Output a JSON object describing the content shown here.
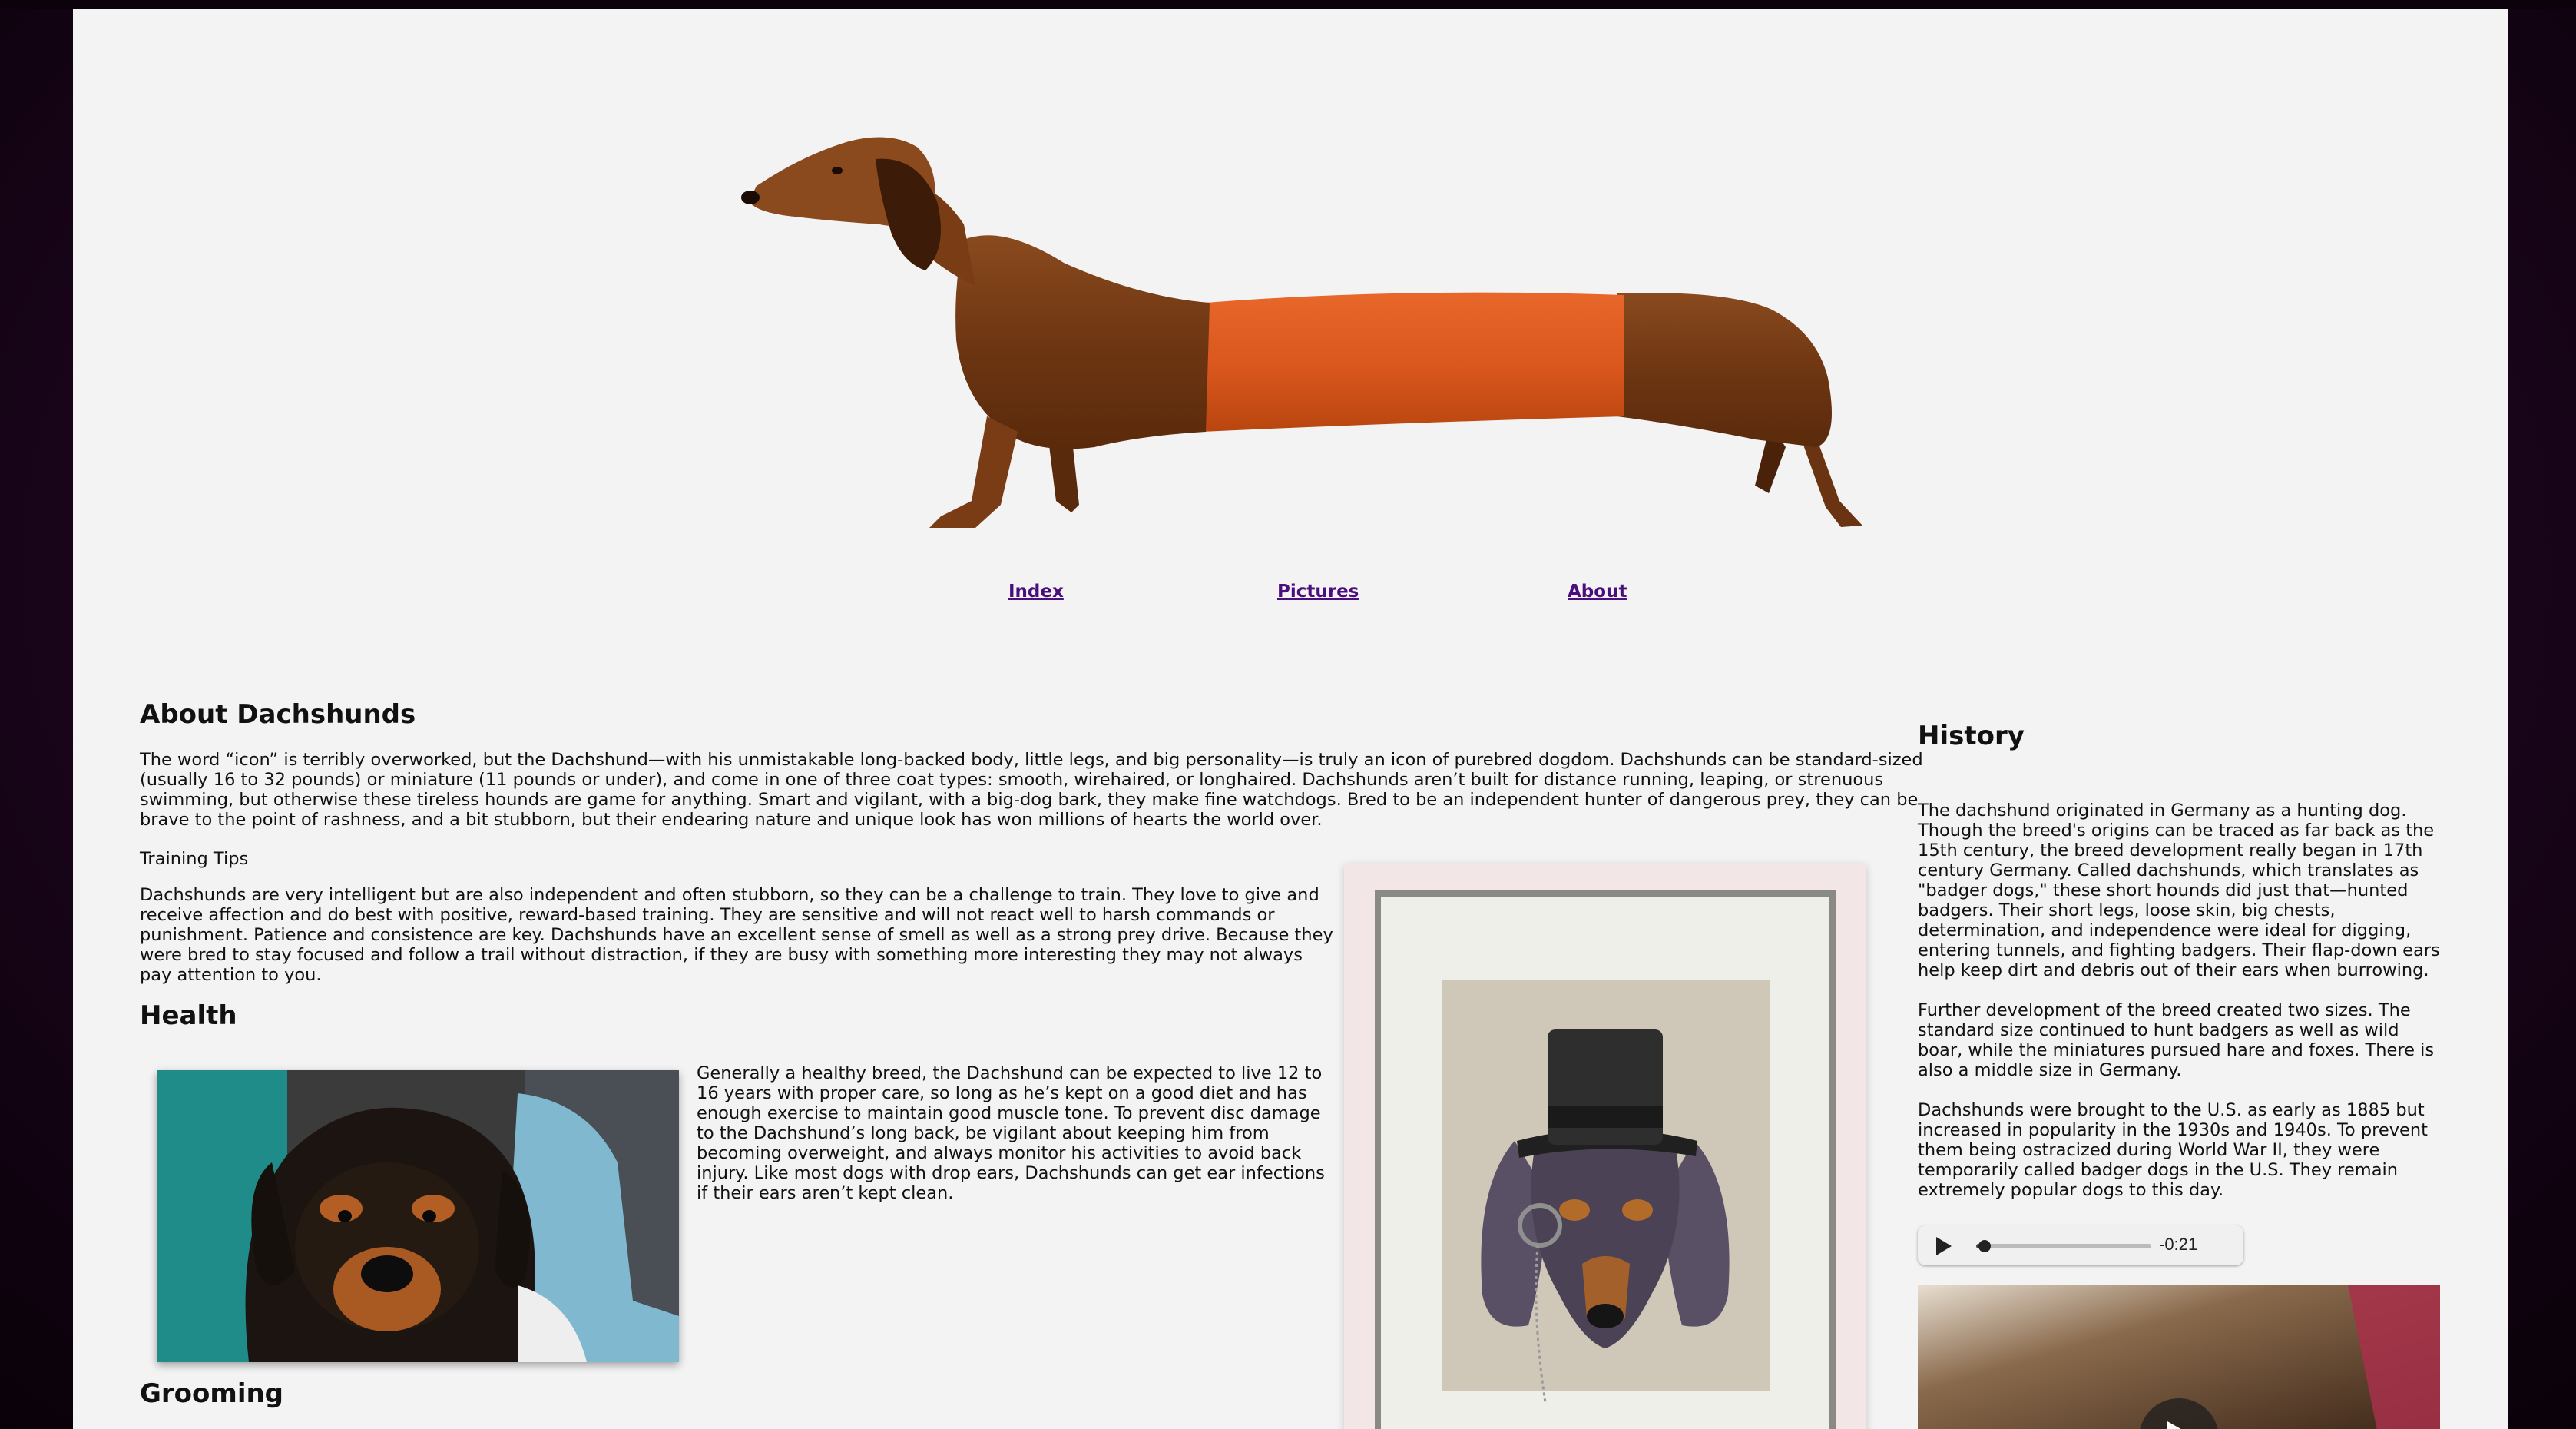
{
  "nav": {
    "index": "Index",
    "pictures": "Pictures",
    "about": "About"
  },
  "about": {
    "title": "About Dachshunds",
    "intro": "The word “icon” is terribly overworked, but the Dachshund—with his unmistakable long-backed body, little legs, and big personality—is truly an icon of purebred dogdom. Dachshunds can be standard-sized (usually 16 to 32 pounds) or miniature (11 pounds or under), and come in one of three coat types: smooth, wirehaired, or longhaired. Dachshunds aren’t built for distance running, leaping, or strenuous swimming, but otherwise these tireless hounds are game for anything. Smart and vigilant, with a big-dog bark, they make fine watchdogs. Bred to be an independent hunter of dangerous prey, they can be brave to the point of rashness, and a bit stubborn, but their endearing nature and unique look has won millions of hearts the world over.",
    "training_label": "Training Tips",
    "training": "Dachshunds are very intelligent but are also independent and often stubborn, so they can be a challenge to train. They love to give and receive affection and do best with positive, reward-based training. They are sensitive and will not react well to harsh commands or punishment. Patience and consistence are key. Dachshunds have an excellent sense of smell as well as a strong prey drive. Because they were bred to stay focused and follow a trail without distraction, if they are busy with something more interesting they may not always pay attention to you."
  },
  "health": {
    "title": "Health",
    "text": "Generally a healthy breed, the Dachshund can be expected to live 12 to 16 years with proper care, so long as he’s kept on a good diet and has enough exercise to maintain good muscle tone. To prevent disc damage to the Dachshund’s long back, be vigilant about keeping him from becoming overweight, and always monitor his activities to avoid back injury. Like most dogs with drop ears, Dachshunds can get ear infections if their ears aren’t kept clean."
  },
  "grooming": {
    "title": "Grooming"
  },
  "history": {
    "title": "History",
    "p1": "The dachshund originated in Germany as a hunting dog. Though the breed's origins can be traced as far back as the 15th century, the breed development really began in 17th century Germany. Called dachshunds, which translates as \"badger dogs,\" these short hounds did just that—hunted badgers. Their short legs, loose skin, big chests, determination, and independence were ideal for digging, entering tunnels, and fighting badgers. Their flap-down ears help keep dirt and debris out of their ears when burrowing.",
    "p2": "Further development of the breed created two sizes. The standard size continued to hunt badgers as well as wild boar, while the miniatures pursued hare and foxes. There is also a middle size in Germany.",
    "p3": "Dachshunds were brought to the U.S. as early as 1885 but increased in popularity in the 1930s and 1940s. To prevent them being ostracized during World War II, they were temporarily called badger dogs in the U.S. They remain extremely popular dogs to this day."
  },
  "audio": {
    "time": "-0:21",
    "progress": 0.03
  },
  "icons": {
    "play": "play-icon",
    "video_play": "video-play-icon"
  }
}
